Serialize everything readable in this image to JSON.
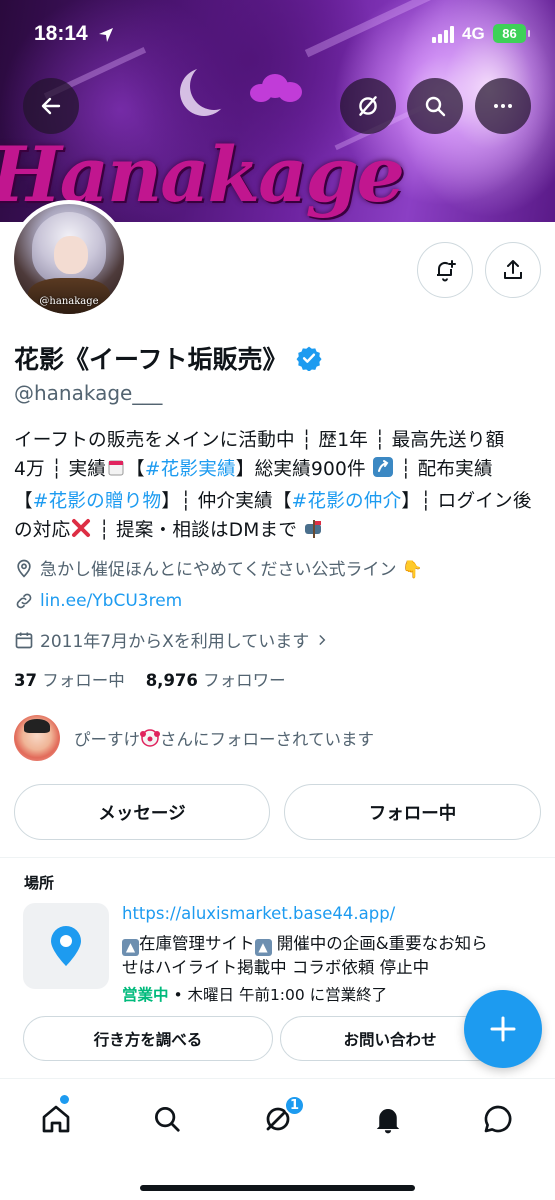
{
  "status_bar": {
    "time": "18:14",
    "network": "4G",
    "battery": "86"
  },
  "banner": {
    "wordmark": "Hanakage"
  },
  "avatar": {
    "handle_text": "@hanakage"
  },
  "profile": {
    "display_name": "花影《イーフト垢販売》",
    "handle": "@hanakage___",
    "bio": {
      "l1": "イーフトの販売をメインに活動中 ┆ 歴1年 ┆ 最高先送り額",
      "l2a": "4万 ┆ 実績",
      "l2_tag": "#花影実績",
      "l2b": "】総実績900件",
      "l2c": " ┆ 配布実績",
      "l3_open": "【",
      "l3_tag1": "#花影の贈り物",
      "l3_mid": "】┆ 仲介実績【",
      "l3_tag2": "#花影の仲介",
      "l3_end": "】┆ ログイン後",
      "l4a": "の対応",
      "l4b": " ┆ 提案・相談はDMまで"
    },
    "location": "急かし催促ほんとにやめてください公式ライン 👇",
    "website": "lin.ee/YbCU3rem",
    "joined": "2011年7月からXを利用しています",
    "following_count": "37",
    "following_label": "フォロー中",
    "followers_count": "8,976",
    "followers_label": "フォロワー",
    "followed_by_name": "ぴーすけ",
    "followed_by_suffix": "さんにフォローされています"
  },
  "actions": {
    "message": "メッセージ",
    "following": "フォロー中"
  },
  "location_card": {
    "title": "場所",
    "url": "https://aluxismarket.base44.app/",
    "desc_l1": "在庫管理サイト",
    "desc_l1b": " 開催中の企画&重要なお知ら",
    "desc_l2": "せはハイライト掲載中 コラボ依頼 停止中",
    "hours_status": "営業中",
    "hours_text": " • 木曜日 午前1:00 に営業終了",
    "directions": "行き方を調べる",
    "contact": "お問い合わせ"
  },
  "tabbar": {
    "messages_badge": "1"
  },
  "colors": {
    "accent": "#1d9bf0",
    "open": "#00ba7c",
    "secondary_text": "#536471",
    "border": "#cfd9de"
  },
  "icons": [
    "back-arrow-icon",
    "no-notifications-icon",
    "search-icon",
    "more-icon",
    "notify-bell-icon",
    "share-icon",
    "verified-icon",
    "location-pin-icon",
    "link-icon",
    "calendar-icon",
    "map-pin-icon",
    "compose-plus-icon",
    "home-icon",
    "explore-icon",
    "grok-icon",
    "notifications-icon",
    "messages-icon"
  ]
}
